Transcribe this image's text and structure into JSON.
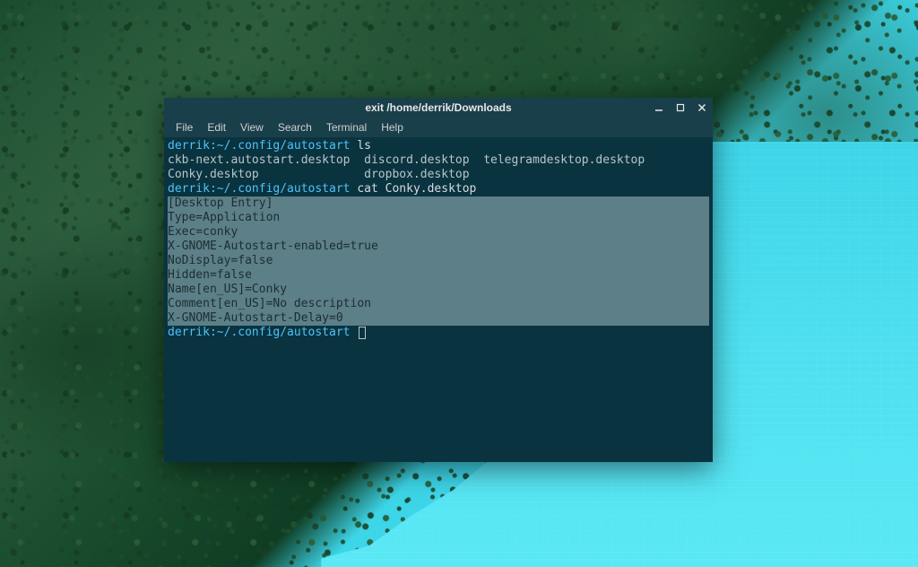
{
  "window": {
    "title": "exit /home/derrik/Downloads"
  },
  "menubar": {
    "items": [
      "File",
      "Edit",
      "View",
      "Search",
      "Terminal",
      "Help"
    ]
  },
  "terminal": {
    "prompt": "derrik:~/.config/autostart",
    "lines": [
      {
        "type": "cmd",
        "prompt": "derrik:~/.config/autostart",
        "command": "ls"
      },
      {
        "type": "out",
        "text": "ckb-next.autostart.desktop  discord.desktop  telegramdesktop.desktop"
      },
      {
        "type": "out",
        "text": "Conky.desktop               dropbox.desktop"
      },
      {
        "type": "cmd",
        "prompt": "derrik:~/.config/autostart",
        "command": "cat Conky.desktop"
      },
      {
        "type": "sel",
        "text": "[Desktop Entry]"
      },
      {
        "type": "sel",
        "text": "Type=Application"
      },
      {
        "type": "sel",
        "text": "Exec=conky"
      },
      {
        "type": "sel",
        "text": "X-GNOME-Autostart-enabled=true"
      },
      {
        "type": "sel",
        "text": "NoDisplay=false"
      },
      {
        "type": "sel",
        "text": "Hidden=false"
      },
      {
        "type": "sel",
        "text": "Name[en_US]=Conky"
      },
      {
        "type": "sel",
        "text": "Comment[en_US]=No description"
      },
      {
        "type": "sel",
        "text": "X-GNOME-Autostart-Delay=0"
      },
      {
        "type": "prompt-cursor",
        "prompt": "derrik:~/.config/autostart"
      }
    ]
  },
  "colors": {
    "prompt": "#4fc3f7",
    "terminal_bg": "#0a3340",
    "titlebar_bg": "#193f4a",
    "selection_bg": "#5d7f87",
    "text": "#b8c5c8"
  }
}
